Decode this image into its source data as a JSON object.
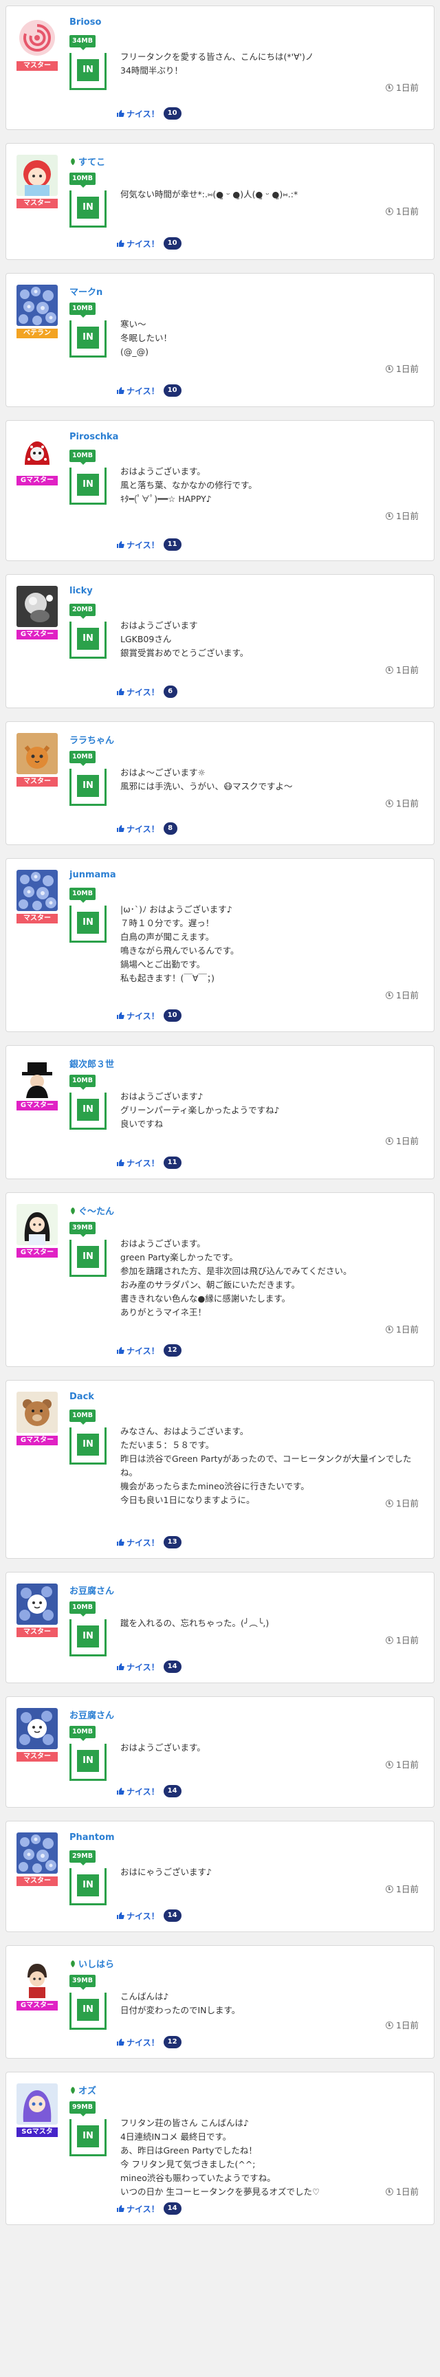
{
  "labels": {
    "nice": "ナイス！",
    "time": "1日前",
    "in": "IN"
  },
  "colors": {
    "accent_green": "#2ba14a",
    "link_blue": "#2b7fd3",
    "badge_navy": "#1e2f72"
  },
  "posts": [
    {
      "user": "Brioso",
      "leaf": false,
      "rank": "マスター",
      "rank_color": "#f05a66",
      "avatar": "swirl-avatar",
      "mb": "34MB",
      "lines": [
        "フリータンクを愛する皆さん、こんにちは(*'∀')ノ",
        "34時間半ぶり！"
      ],
      "likes": "10"
    },
    {
      "user": "すてこ",
      "leaf": true,
      "rank": "マスター",
      "rank_color": "#f05a66",
      "avatar": "redhair-avatar",
      "mb": "10MB",
      "lines": [
        "何気ない時間が幸せ*:.⑅(●͈ ᵕ ●͈)人(●͈ ᵕ ●͈)⑅.:*"
      ],
      "likes": "10"
    },
    {
      "user": "マークn",
      "leaf": false,
      "rank": "ベテラン",
      "rank_color": "#f3a322",
      "avatar": "hydrangea-avatar",
      "mb": "10MB",
      "lines": [
        "寒い～",
        "冬眠したい！",
        "(@_@)"
      ],
      "likes": "10"
    },
    {
      "user": "Piroschka",
      "leaf": false,
      "rank": "Gマスター",
      "rank_color": "#e021c4",
      "avatar": "dotmask-avatar",
      "mb": "10MB",
      "lines": [
        "おはようございます。",
        "風と落ち葉、なかなかの修行です。",
        "ｷﾀ━(ﾟ∀ﾟ)━━☆ HAPPY♪"
      ],
      "likes": "11"
    },
    {
      "user": "licky",
      "leaf": false,
      "rank": "Gマスター",
      "rank_color": "#e021c4",
      "avatar": "bird-avatar",
      "mb": "20MB",
      "lines": [
        "おはようございます",
        "LGKB09さん",
        "銀賞受賞おめでとうございます。"
      ],
      "likes": "6"
    },
    {
      "user": "ララちゃん",
      "leaf": false,
      "rank": "マスター",
      "rank_color": "#f05a66",
      "avatar": "cat-avatar",
      "mb": "10MB",
      "lines": [
        "おはよ〜ございます☼",
        "風邪には手洗い、うがい、😷マスクですよ〜"
      ],
      "likes": "8"
    },
    {
      "user": "junmama",
      "leaf": false,
      "rank": "マスター",
      "rank_color": "#f05a66",
      "avatar": "hydrangea-avatar",
      "mb": "10MB",
      "lines": [
        "|ω･`)ﾉ おはようございます♪",
        "７時１０分です。遅っ！",
        "白鳥の声が聞こえます。",
        "鳴きながら飛んでいるんです。",
        "鍋場へとご出勤です。",
        "私も起きます！(￣∀￣；)"
      ],
      "likes": "10"
    },
    {
      "user": "銀次郎３世",
      "leaf": false,
      "rank": "Gマスター",
      "rank_color": "#e021c4",
      "avatar": "hat-avatar",
      "mb": "10MB",
      "lines": [
        "おはようございます♪",
        "グリーンパーティ楽しかったようですね♪",
        "良いですね"
      ],
      "likes": "11"
    },
    {
      "user": "ぐ～たん",
      "leaf": true,
      "rank": "Gマスター",
      "rank_color": "#e021c4",
      "avatar": "girl-avatar",
      "mb": "39MB",
      "lines": [
        "おはようございます。",
        "green Party楽しかったです。",
        "参加を躊躇された方、是非次回は飛び込んでみてください。",
        "おみ産のサラダパン、朝ご飯にいただきます。",
        "書ききれない色んな●縁に感謝いたします。",
        "ありがとうマイネ王！"
      ],
      "likes": "12"
    },
    {
      "user": "Dack",
      "leaf": false,
      "rank": "Gマスター",
      "rank_color": "#e021c4",
      "avatar": "bear-avatar",
      "mb": "10MB",
      "lines": [
        "みなさん、おはようございます。",
        "ただいま５：５８です。",
        "昨日は渋谷でGreen Partyがあったので、コーヒータンクが大量インでしたね。",
        "機会があったらまたmineo渋谷に行きたいです。",
        "今日も良い1日になりますように。"
      ],
      "likes": "13"
    },
    {
      "user": "お豆腐さん",
      "leaf": false,
      "rank": "マスター",
      "rank_color": "#f05a66",
      "avatar": "blueflower-avatar",
      "mb": "10MB",
      "lines": [
        "蹴を入れるの、忘れちゃった。(╯︵╰,)"
      ],
      "likes": "14"
    },
    {
      "user": "お豆腐さん",
      "leaf": false,
      "rank": "マスター",
      "rank_color": "#f05a66",
      "avatar": "blueflower-avatar",
      "mb": "10MB",
      "lines": [
        "おはようございます。"
      ],
      "likes": "14"
    },
    {
      "user": "Phantom",
      "leaf": false,
      "rank": "マスター",
      "rank_color": "#f05a66",
      "avatar": "hydrangea-avatar",
      "mb": "29MB",
      "lines": [
        "おはにゃうございます♪"
      ],
      "likes": "14"
    },
    {
      "user": "いしはら",
      "leaf": true,
      "rank": "Gマスター",
      "rank_color": "#e021c4",
      "avatar": "boy-avatar",
      "mb": "39MB",
      "lines": [
        "こんばんは♪",
        "日付が変わったのでINします。"
      ],
      "likes": "12"
    },
    {
      "user": "オズ",
      "leaf": true,
      "rank": "SGマスタ",
      "rank_color": "#4624c9",
      "avatar": "anime-avatar",
      "mb": "99MB",
      "lines": [
        "フリタン荘の皆さん こんばんは♪",
        "4日連続INコメ 最終日です。",
        "あ、昨日はGreen Partyでしたね！",
        "今 フリタン見て気づきました(^^;",
        "mineo渋谷も賑わっていたようですね。",
        "いつの日か 生コーヒータンクを夢見るオズでした♡"
      ],
      "likes": "14"
    }
  ]
}
